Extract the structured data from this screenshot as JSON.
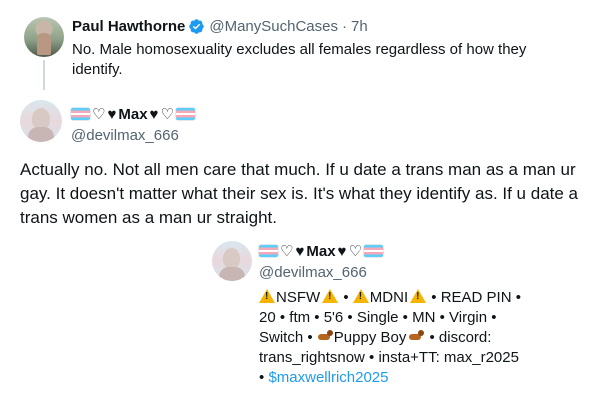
{
  "parent_tweet": {
    "display_name": "Paul Hawthorne",
    "handle": "@ManySuchCases",
    "separator": "·",
    "time": "7h",
    "text": "No. Male homosexuality excludes all females regardless of how they identify.",
    "verified_color": "#1d9bf0"
  },
  "reply": {
    "display_name": "Max",
    "handle": "@devilmax_666",
    "text": "Actually no. Not all men care that much. If u date a trans man as a man ur gay. It doesn't matter what their sex is. It's what they identify as. If u date a trans women as a man ur straight."
  },
  "profile_card": {
    "display_name": "Max",
    "handle": "@devilmax_666",
    "bio": {
      "nsfw": "NSFW",
      "mdni": "MDNI",
      "sep_dot": "•",
      "read_pin": "• READ PIN •",
      "line2": "20 • ftm • 5'6 • Single • MN • Virgin •",
      "switch": "Switch •",
      "puppy": "Puppy Boy",
      "discord": "• discord:",
      "line4": "trans_rightsnow • insta+TT: max_r2025",
      "bullet": "•",
      "cashtag": "$maxwellrich2025"
    },
    "link_color": "#1d9bf0"
  },
  "icons": {
    "verified": "verified-badge-icon",
    "trans_flag": "trans-flag-emoji",
    "warning": "warning-emoji",
    "dog": "dog-emoji",
    "heart_outline": "♡",
    "heart_filled": "♥"
  }
}
